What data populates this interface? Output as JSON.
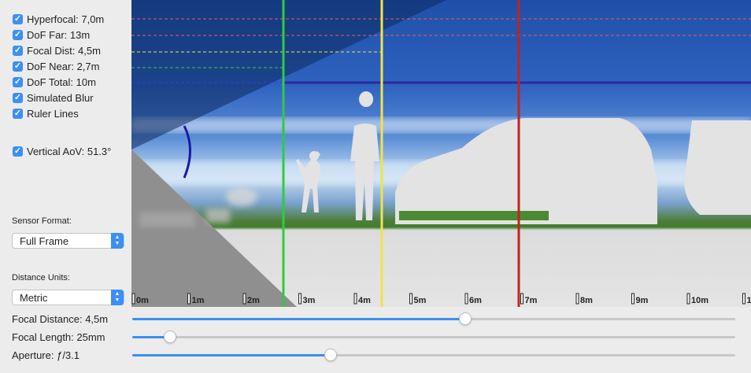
{
  "checkboxes": [
    {
      "label": "Hyperfocal: 7,0m",
      "checked": true
    },
    {
      "label": "DoF Far: 13m",
      "checked": true
    },
    {
      "label": "Focal Dist: 4,5m",
      "checked": true
    },
    {
      "label": "DoF Near: 2,7m",
      "checked": true
    },
    {
      "label": "DoF Total: 10m",
      "checked": true
    },
    {
      "label": "Simulated Blur",
      "checked": true
    },
    {
      "label": "Ruler Lines",
      "checked": true
    },
    {
      "label": "Vertical AoV: 51.3°",
      "checked": true
    }
  ],
  "sensor": {
    "label": "Sensor Format:",
    "value": "Full Frame"
  },
  "units": {
    "label": "Distance Units:",
    "value": "Metric"
  },
  "sliders": [
    {
      "label": "Focal Distance: 4,5m",
      "fraction": 0.552
    },
    {
      "label": "Focal Length: 25mm",
      "fraction": 0.063
    },
    {
      "label": "Aperture: ƒ/3.1",
      "fraction": 0.329
    }
  ],
  "ruler": {
    "labels": [
      "0m",
      "1m",
      "2m",
      "3m",
      "4m",
      "5m",
      "6m",
      "7m",
      "8m",
      "9m",
      "10m",
      "1"
    ]
  },
  "distances_m": {
    "dof_near": 2.7,
    "focal": 4.5,
    "hyperfocal": 7.0,
    "dof_far": 13
  },
  "colors": {
    "dof_near": "#2ecc3e",
    "focal": "#f2e24a",
    "hyperfocal": "#c0231f",
    "dof_far": "#e06060",
    "dof_total": "#2a2a9e",
    "accent": "#3b8ff5"
  }
}
